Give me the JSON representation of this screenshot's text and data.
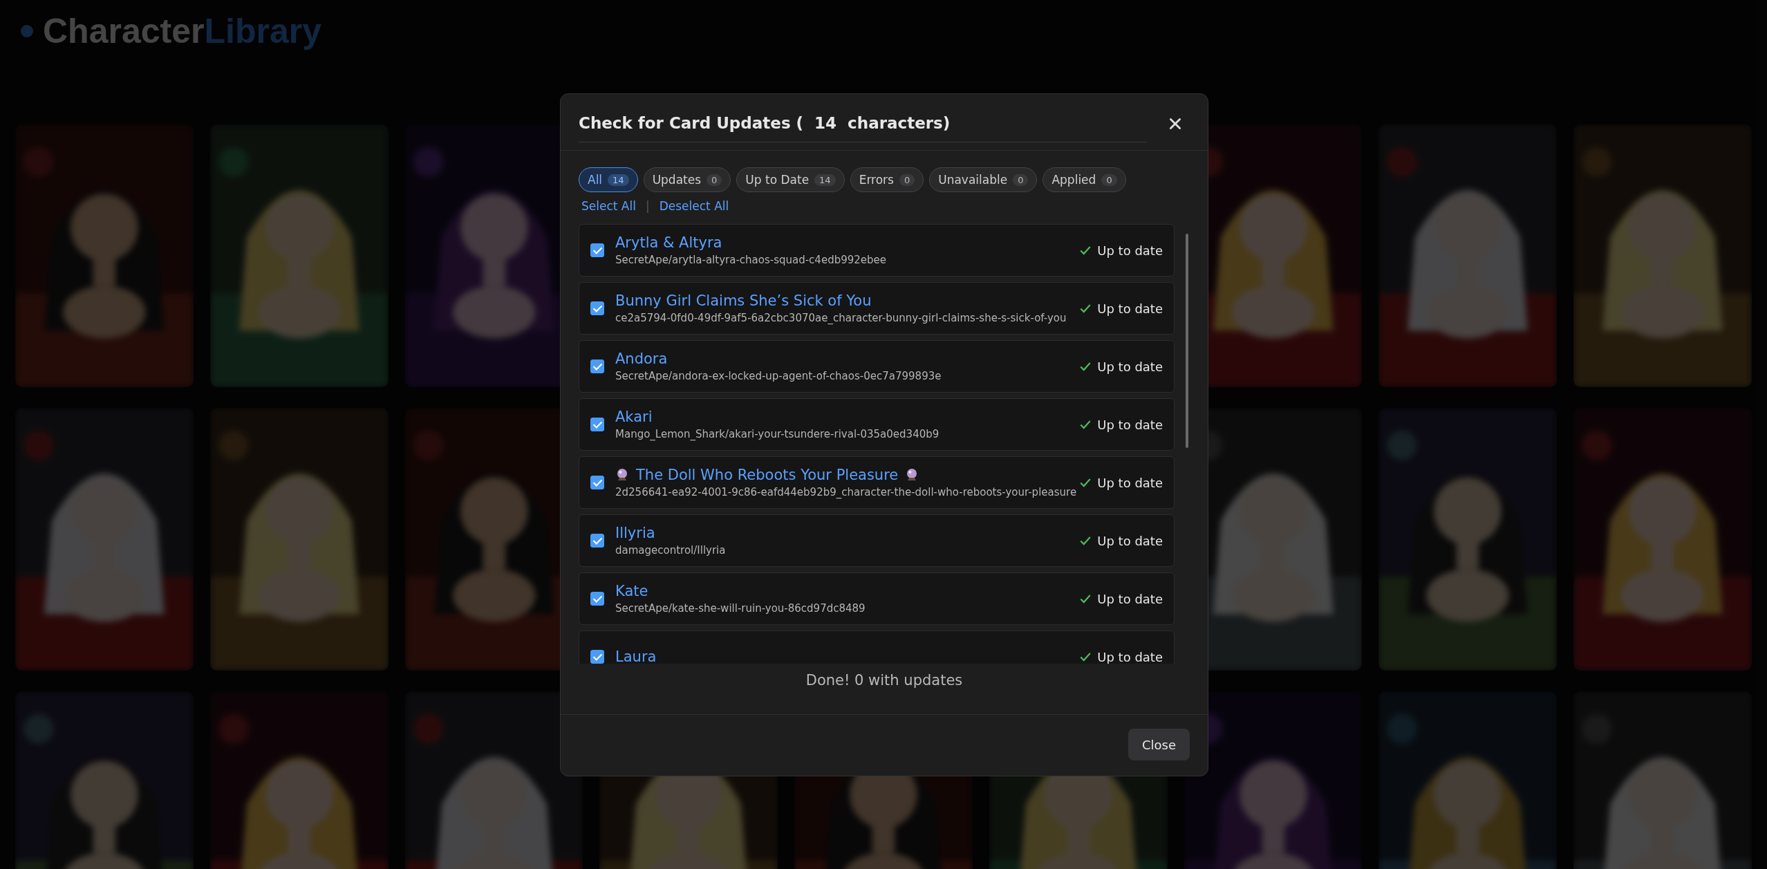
{
  "app": {
    "logo_main": "Character",
    "logo_accent": "Library"
  },
  "dialog": {
    "title": "Check for Card Updates (  14  characters)",
    "filters": [
      {
        "label": "All",
        "count": "14",
        "selected": true
      },
      {
        "label": "Updates",
        "count": "0",
        "selected": false
      },
      {
        "label": "Up to Date",
        "count": "14",
        "selected": false
      },
      {
        "label": "Errors",
        "count": "0",
        "selected": false
      },
      {
        "label": "Unavailable",
        "count": "0",
        "selected": false
      },
      {
        "label": "Applied",
        "count": "0",
        "selected": false
      }
    ],
    "select_all": "Select All",
    "separator": "|",
    "deselect_all": "Deselect All",
    "items": [
      {
        "name": "Arytla & Altyra",
        "path": "SecretApe/arytla-altyra-chaos-squad-c4edb992ebee",
        "checked": true,
        "ornamented": false,
        "status": "Up to date"
      },
      {
        "name": "Bunny Girl Claims She’s Sick of You",
        "path": "ce2a5794-0fd0-49df-9af5-6a2cbc3070ae_character-bunny-girl-claims-she-s-sick-of-you",
        "checked": true,
        "ornamented": false,
        "status": "Up to date"
      },
      {
        "name": "Andora",
        "path": "SecretApe/andora-ex-locked-up-agent-of-chaos-0ec7a799893e",
        "checked": true,
        "ornamented": false,
        "status": "Up to date"
      },
      {
        "name": "Akari",
        "path": "Mango_Lemon_Shark/akari-your-tsundere-rival-035a0ed340b9",
        "checked": true,
        "ornamented": false,
        "status": "Up to date"
      },
      {
        "name": "The Doll Who Reboots Your Pleasure",
        "path": "2d256641-ea92-4001-9c86-eafd44eb92b9_character-the-doll-who-reboots-your-pleasure",
        "checked": true,
        "ornamented": true,
        "status": "Up to date"
      },
      {
        "name": "Illyria",
        "path": "damagecontrol/Illyria",
        "checked": true,
        "ornamented": false,
        "status": "Up to date"
      },
      {
        "name": "Kate",
        "path": "SecretApe/kate-she-will-ruin-you-86cd97dc8489",
        "checked": true,
        "ornamented": false,
        "status": "Up to date"
      },
      {
        "name": "Laura",
        "checked": true,
        "ornamented": false,
        "status": "Up to date"
      }
    ],
    "summary": "Done! 0 with updates",
    "close_label": "Close"
  }
}
